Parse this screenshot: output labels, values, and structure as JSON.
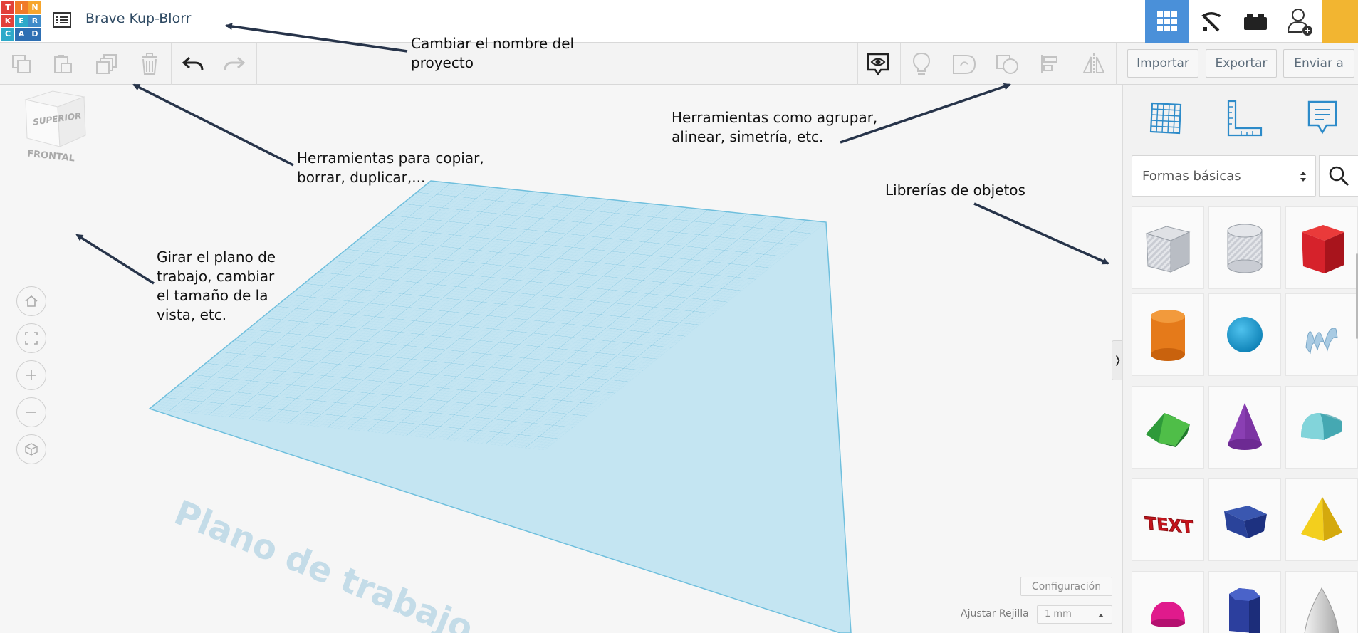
{
  "header": {
    "logo_letters": [
      "T",
      "I",
      "N",
      "K",
      "E",
      "R",
      "C",
      "A",
      "D"
    ],
    "logo_colors": [
      "#e2403a",
      "#f07a28",
      "#f6a52c",
      "#e2403a",
      "#2da9c9",
      "#3f8bc9",
      "#2da9c9",
      "#2e6fb3",
      "#2e6fb3"
    ],
    "project_name": "Brave Kup-Blorr"
  },
  "toolbar": {
    "import_label": "Importar",
    "export_label": "Exportar",
    "send_label": "Enviar a"
  },
  "viewcube": {
    "top_label": "SUPERIOR",
    "front_label": "FRONTAL"
  },
  "workplane": {
    "label": "Plano de trabajo"
  },
  "bottom": {
    "settings_label": "Configuración",
    "snap_label": "Ajustar Rejilla",
    "snap_value": "1 mm"
  },
  "panel": {
    "library_select": "Formas básicas",
    "collapse_glyph": "❭",
    "shapes": [
      {
        "name": "box-hole"
      },
      {
        "name": "cylinder-hole"
      },
      {
        "name": "box"
      },
      {
        "name": "cylinder"
      },
      {
        "name": "sphere"
      },
      {
        "name": "scribble"
      },
      {
        "name": "roof"
      },
      {
        "name": "cone"
      },
      {
        "name": "round-roof"
      },
      {
        "name": "text"
      },
      {
        "name": "wedge"
      },
      {
        "name": "pyramid"
      },
      {
        "name": "half-sphere"
      },
      {
        "name": "polygon"
      },
      {
        "name": "paraboloid"
      }
    ],
    "text_shape_label": "TEXT"
  },
  "annotations": {
    "rename_line1": "Cambiar el nombre del",
    "rename_line2": "proyecto",
    "copy_line1": "Herramientas para copiar,",
    "copy_line2": "borrar, duplicar,...",
    "group_line1": "Herramientas como agrupar,",
    "group_line2": "alinear, simetría, etc.",
    "library": "Librerías de objetos",
    "rotate_line1": "Girar el plano de",
    "rotate_line2": "trabajo, cambiar",
    "rotate_line3": "el tamaño de la",
    "rotate_line4": "vista, etc."
  },
  "colors": {
    "accent_blue": "#4a90d9",
    "accent_yellow": "#f2b531",
    "grid_blue": "#8fd0ea"
  }
}
